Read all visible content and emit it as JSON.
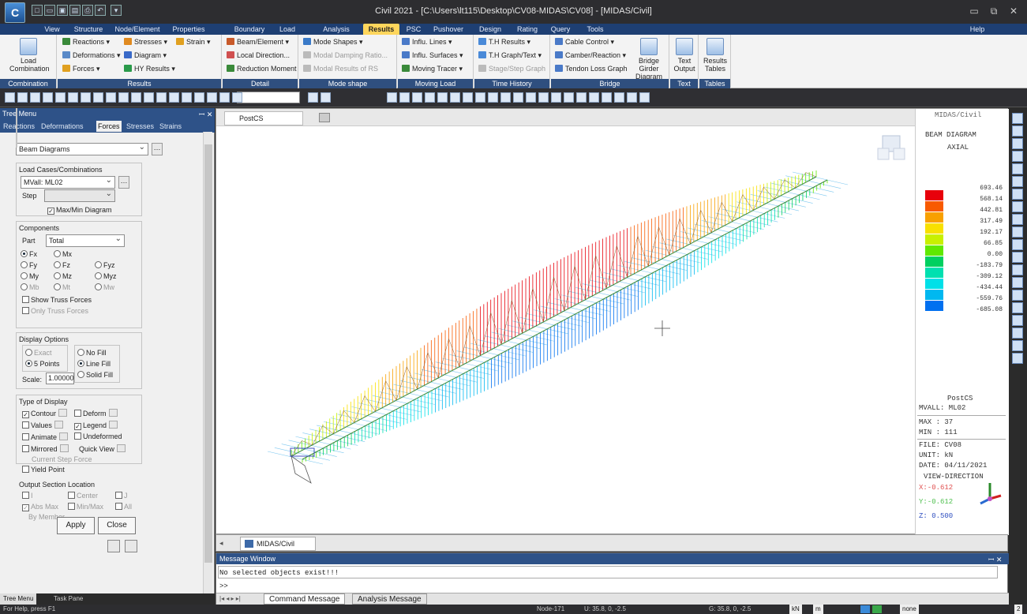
{
  "window": {
    "title": "Civil 2021 - [C:\\Users\\lt115\\Desktop\\CV08-MIDAS\\CV08] - [MIDAS/Civil]",
    "help": "Help"
  },
  "menu": [
    "View",
    "Structure",
    "Node/Element",
    "Properties",
    "Boundary",
    "Load",
    "Analysis",
    "Results",
    "PSC",
    "Pushover",
    "Design",
    "Rating",
    "Query",
    "Tools"
  ],
  "menu_active": "Results",
  "ribbon": {
    "combination": {
      "label": "Load\nCombination",
      "group": "Combination"
    },
    "results": {
      "items": [
        "Reactions",
        "Stresses",
        "Strain",
        "Deformations",
        "Diagram",
        "Forces",
        "HY Results"
      ],
      "group": "Results"
    },
    "detail": {
      "items": [
        "Beam/Element",
        "Local Direction...",
        "Reduction Moment"
      ],
      "group": "Detail"
    },
    "mode": {
      "items": [
        "Mode Shapes",
        "Modal Damping Ratio...",
        "Modal Results of RS"
      ],
      "group": "Mode shape"
    },
    "moving": {
      "items": [
        "Influ. Lines",
        "Influ. Surfaces",
        "Moving Tracer"
      ],
      "group": "Moving Load"
    },
    "time": {
      "items": [
        "T.H Results",
        "T.H Graph/Text",
        "Stage/Step Graph"
      ],
      "group": "Time History"
    },
    "bridge": {
      "items": [
        "Cable Control",
        "Camber/Reaction",
        "Tendon Loss Graph"
      ],
      "big": "Bridge Girder\nDiagram",
      "group": "Bridge"
    },
    "text": {
      "big": "Text\nOutput",
      "group": "Text"
    },
    "tables": {
      "big": "Results\nTables",
      "group": "Tables"
    }
  },
  "tree": {
    "title": "Tree Menu",
    "tabs": [
      "Reactions",
      "Deformations",
      "Forces",
      "Stresses",
      "Strains"
    ],
    "active_tab": "Forces",
    "diagram_select": "Beam Diagrams",
    "load_cases_label": "Load Cases/Combinations",
    "load_case": "MVall: ML02",
    "step_label": "Step",
    "maxmin_label": "Max/Min Diagram",
    "components_label": "Components",
    "part_label": "Part",
    "part_value": "Total",
    "comp": [
      "Fx",
      "Mx",
      "Fy",
      "Fz",
      "Fyz",
      "My",
      "Mz",
      "Myz",
      "Mb",
      "Mt",
      "Mw"
    ],
    "show_truss": "Show Truss Forces",
    "only_truss": "Only Truss Forces",
    "display_options_label": "Display Options",
    "exact": "Exact",
    "five_points": "5 Points",
    "no_fill": "No Fill",
    "line_fill": "Line Fill",
    "solid_fill": "Solid Fill",
    "scale_label": "Scale:",
    "scale_value": "1.00000",
    "type_label": "Type of Display",
    "types": [
      "Contour",
      "Deform",
      "Values",
      "Legend",
      "Animate",
      "Undeformed",
      "Mirrored",
      "Quick View"
    ],
    "current_step": "Current Step Force",
    "yield_point": "Yield Point",
    "output_loc_label": "Output Section Location",
    "loc": [
      "I",
      "Center",
      "J",
      "Abs Max",
      "Min/Max",
      "All",
      "By Member"
    ],
    "apply": "Apply",
    "close": "Close"
  },
  "bottom_tabs": [
    "Tree Menu",
    "Task Pane"
  ],
  "view": {
    "tab": "PostCS",
    "doc_tab": "MIDAS/Civil"
  },
  "legend": {
    "app": "MIDAS/Civil",
    "title": "BEAM DIAGRAM",
    "subtitle": "AXIAL",
    "values": [
      "693.46",
      "568.14",
      "442.81",
      "317.49",
      "192.17",
      "66.85",
      "0.00",
      "-183.79",
      "-309.12",
      "-434.44",
      "-559.76",
      "-685.08"
    ],
    "colors": [
      "#e8000b",
      "#f85a00",
      "#f8a000",
      "#f8e000",
      "#c8f000",
      "#60e800",
      "#00d060",
      "#00e0b0",
      "#00e0e8",
      "#00b8f0",
      "#0070f0"
    ],
    "stage": "PostCS",
    "case": "MVALL: ML02",
    "max": "MAX : 37",
    "min": "MIN : 111",
    "file": "FILE: CV08",
    "unit": "UNIT: kN",
    "date": "DATE: 04/11/2021",
    "view_dir": "VIEW-DIRECTION",
    "x": "X:-0.612",
    "y": "Y:-0.612",
    "z": "Z: 0.500"
  },
  "message": {
    "title": "Message Window",
    "text": "No selected objects exist!!!",
    "prompt": ">>",
    "tabs": [
      "Command Message",
      "Analysis Message"
    ]
  },
  "status": {
    "help": "For Help, press F1",
    "node": "Node-171",
    "u": "U: 35.8, 0, -2.5",
    "g": "G: 35.8, 0, -2.5",
    "unit_force": "kN",
    "unit_len": "m",
    "mode": "none",
    "page": "2"
  }
}
